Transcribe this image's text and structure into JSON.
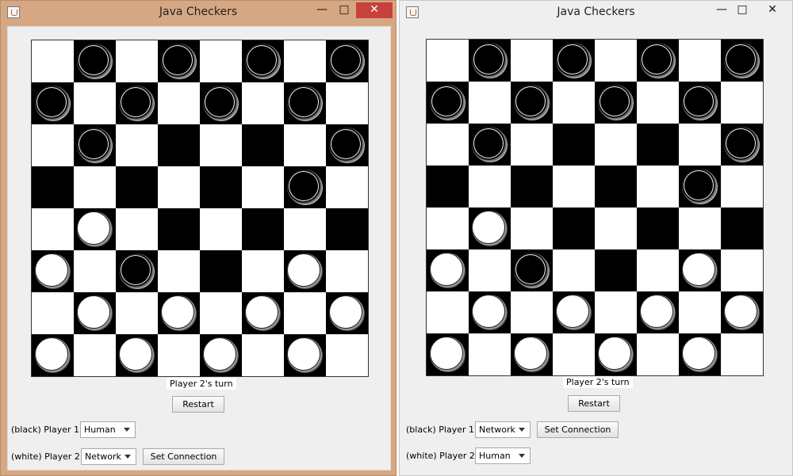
{
  "windows": [
    {
      "title": "Java Checkers",
      "status": "Player 2's turn",
      "restart_label": "Restart",
      "player1_label": "(black) Player 1:",
      "player1_value": "Human",
      "player2_label": "(white) Player 2:",
      "player2_value": "Network",
      "set_connection_label": "Set Connection",
      "set_connection_for": "player2",
      "minimize": "—",
      "maximize": "□",
      "close": "✕"
    },
    {
      "title": "Java Checkers",
      "status": "Player 2's turn",
      "restart_label": "Restart",
      "player1_label": "(black) Player 1:",
      "player1_value": "Network",
      "player2_label": "(white) Player 2:",
      "player2_value": "Human",
      "set_connection_label": "Set Connection",
      "set_connection_for": "player1",
      "minimize": "—",
      "maximize": "□",
      "close": "✕"
    }
  ],
  "board": [
    ".b.b.b.b",
    "b.b.b.b.",
    ".b.....b",
    "......b.",
    ".w......",
    "w.b...w.",
    ".w.w.w.w",
    "w.w.w.w."
  ],
  "colors": {
    "left_frame": "#d6a783",
    "right_frame": "#efefef",
    "dark_square": "#000000",
    "light_square": "#ffffff",
    "close_button": "#c7423a"
  }
}
